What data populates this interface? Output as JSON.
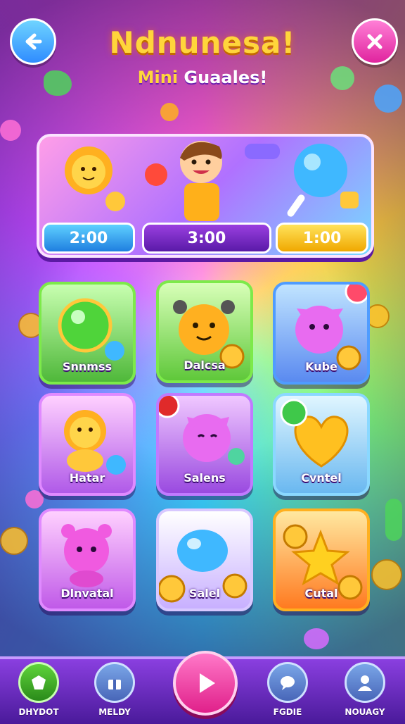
{
  "header": {
    "title": "Ndnunesa!",
    "subtitle_mini": "Mini",
    "subtitle_rest": " Guaales!"
  },
  "icons": {
    "back": "arrow-left-icon",
    "close": "close-icon",
    "play": "play-icon"
  },
  "hero": {
    "timers": [
      "2:00",
      "3:00",
      "1:00"
    ]
  },
  "games": [
    {
      "label": "Snnmss",
      "color": "#5fd03a",
      "art": "green-orb"
    },
    {
      "label": "Dalcsa",
      "color": "#5fd03a",
      "art": "orange-bear"
    },
    {
      "label": "Kube",
      "color": "#3f8cff",
      "art": "pink-creature"
    },
    {
      "label": "Hatar",
      "color": "#d86bff",
      "art": "yellow-lion"
    },
    {
      "label": "Salens",
      "color": "#b05aff",
      "art": "pink-cat"
    },
    {
      "label": "Cvntel",
      "color": "#5fd0ff",
      "art": "yellow-heart"
    },
    {
      "label": "Dlnvatal",
      "color": "#d86bff",
      "art": "pink-bear"
    },
    {
      "label": "Salel",
      "color": "#c8b8ff",
      "art": "blue-candy"
    },
    {
      "label": "Cutal",
      "color": "#ffb020",
      "art": "gold-star"
    }
  ],
  "nav": {
    "items": [
      {
        "label": "DHYDOT",
        "icon": "shop-icon"
      },
      {
        "label": "MELDY",
        "icon": "gift-icon"
      },
      {
        "label": "FGDIE",
        "icon": "chat-icon"
      },
      {
        "label": "NOUAGY",
        "icon": "profile-icon"
      }
    ]
  }
}
